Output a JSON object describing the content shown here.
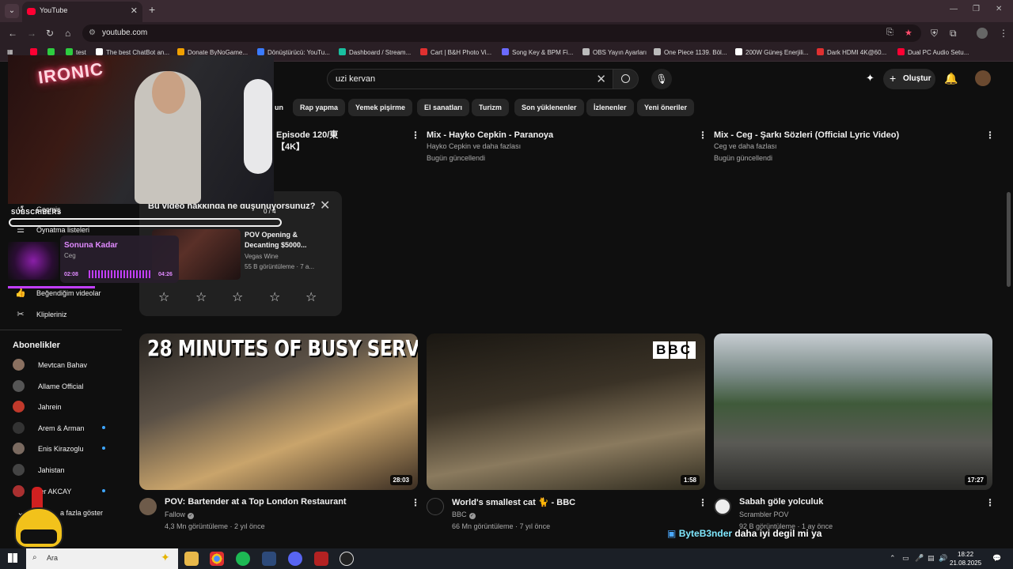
{
  "browser": {
    "tab_title": "YouTube",
    "url": "youtube.com",
    "bookmarks": [
      {
        "label": "test",
        "color": "#2ecc40"
      },
      {
        "label": "The best ChatBot an...",
        "color": "#ffffff"
      },
      {
        "label": "Donate ByNoGame...",
        "color": "#f0a000"
      },
      {
        "label": "Dönüştürücü: YouTu...",
        "color": "#3a7bff"
      },
      {
        "label": "Dashboard / Stream...",
        "color": "#19c0a0"
      },
      {
        "label": "Cart | B&H Photo Vi...",
        "color": "#e03030"
      },
      {
        "label": "Song Key & BPM Fi...",
        "color": "#6a6aff"
      },
      {
        "label": "OBS Yayın Ayarları",
        "color": "#bbbbbb"
      },
      {
        "label": "One Piece 1139. Böl...",
        "color": "#bbbbbb"
      },
      {
        "label": "200W Güneş Enerjili...",
        "color": "#ffffff"
      },
      {
        "label": "Dark HDMI 4K@60...",
        "color": "#e03030"
      },
      {
        "label": "Dual PC Audio Setu...",
        "color": "#ff0033"
      }
    ]
  },
  "header": {
    "search_value": "uzi kervan",
    "create_label": "Oluştur"
  },
  "chips": [
    "un",
    "Rap yapma",
    "Yemek pişirme",
    "El sanatları",
    "Turizm",
    "Son yüklenenler",
    "İzlenenler",
    "Yeni öneriler"
  ],
  "top_row": [
    {
      "title_l1": "Episode 120/東",
      "title_l2": "【4K】"
    },
    {
      "title": "Mix - Hayko Cepkin - Paranoya",
      "meta1": "Hayko Cepkin ve daha fazlası",
      "meta2": "Bugün güncellendi"
    },
    {
      "title": "Mix - Ceg - Şarkı Sözleri (Official Lyric Video)",
      "meta1": "Ceg ve daha fazlası",
      "meta2": "Bugün güncellendi"
    }
  ],
  "sidebar": {
    "items": [
      "Geçmiş",
      "Oynatma listeleri",
      "Beğendiğim videolar",
      "Klipleriniz"
    ],
    "subscriptions_title": "Abonelikler",
    "subscriptions": [
      {
        "name": "Mevtcan Bahav",
        "new": false
      },
      {
        "name": "Allame Official",
        "new": false
      },
      {
        "name": "Jahrein",
        "new": false
      },
      {
        "name": "Arem & Arman",
        "new": true
      },
      {
        "name": "Enis Kirazoglu",
        "new": true
      },
      {
        "name": "Jahistan",
        "new": false
      },
      {
        "name": "fer AKCAY",
        "new": true
      }
    ],
    "show_more": "a fazla göster"
  },
  "survey": {
    "question": "Bu video hakkında ne düşünüyorsunuz?",
    "count": "0 / 4",
    "video_title": "POV Opening & Decanting $5000...",
    "channel": "Vegas Wine",
    "meta": "55 B görüntüleme · 7 a..."
  },
  "videos": [
    {
      "thumb_text": "28 MINUTES OF BUSY SERVICE",
      "duration": "28:03",
      "title": "POV: Bartender at a Top London Restaurant",
      "channel": "Fallow",
      "views": "4,3 Mn görüntüleme",
      "age": "2 yıl önce"
    },
    {
      "thumb_text": "BBC",
      "duration": "1:58",
      "title": "World's smallest cat 🐈 - BBC",
      "channel": "BBC",
      "views": "66 Mn görüntüleme",
      "age": "7 yıl önce"
    },
    {
      "thumb_text": "",
      "duration": "17:27",
      "title": "Sabah göle yolculuk",
      "channel": "Scrambler POV",
      "views": "92 B görüntüleme",
      "age": "1 ay önce"
    }
  ],
  "overlay": {
    "neon_sign": "IRONIC",
    "subscribers_label": "SUBSCRIBERS",
    "song": "Sonuna Kadar",
    "artist": "Ceg",
    "time_current": "02:08",
    "time_total": "04:26",
    "chat_user": "ByteB3nder",
    "chat_message": "daha iyi degil mi ya"
  },
  "taskbar": {
    "search_label": "Ara",
    "time": "18:22",
    "date": "21.08.2025"
  }
}
